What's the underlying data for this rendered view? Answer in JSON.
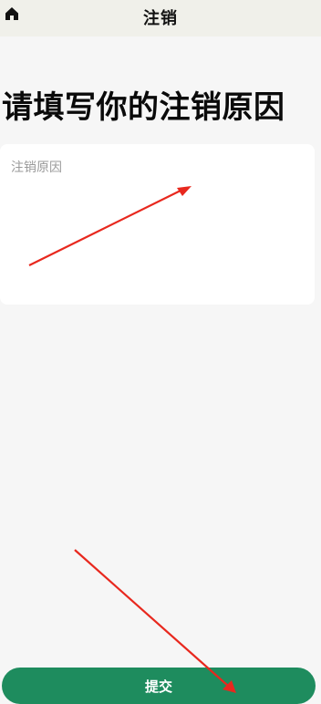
{
  "header": {
    "title": "注销",
    "home_icon": "home-icon"
  },
  "main": {
    "heading": "请填写你的注销原因",
    "reason_field": {
      "placeholder": "注销原因",
      "value": ""
    },
    "submit_label": "提交"
  },
  "colors": {
    "header_bg": "#f0f0ea",
    "page_bg": "#f6f6f6",
    "accent": "#1e8c5e",
    "annotation": "#e8281e"
  },
  "annotations": [
    {
      "name": "annotation-arrow-to-reason-field",
      "color": "#e8281e"
    },
    {
      "name": "annotation-arrow-to-submit",
      "color": "#e8281e"
    }
  ]
}
